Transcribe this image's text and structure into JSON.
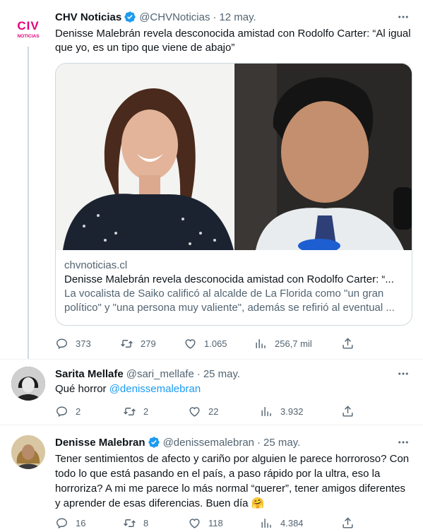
{
  "tweets": [
    {
      "name": "CHV Noticias",
      "handle": "@CHVNoticias",
      "separator": "·",
      "date": "12 may.",
      "logo_text": "NOTICIAS",
      "text": "Denisse Malebrán revela desconocida amistad con Rodolfo Carter: “Al igual que yo, es un tipo que viene de abajo”",
      "card": {
        "domain": "chvnoticias.cl",
        "title": "Denisse Malebrán revela desconocida amistad con Rodolfo Carter: “...",
        "desc": "La vocalista de Saiko calificó al alcalde de La Florida como \"un gran político\" y \"una persona muy valiente\", además se refirió al eventual ..."
      },
      "stats": {
        "replies": "373",
        "retweets": "279",
        "likes": "1.065",
        "views": "256,7 mil"
      }
    },
    {
      "name": "Sarita Mellafe",
      "handle": "@sari_mellafe",
      "separator": "·",
      "date": "25 may.",
      "text_plain": "Qué horror ",
      "mention": "@denissemalebran",
      "stats": {
        "replies": "2",
        "retweets": "2",
        "likes": "22",
        "views": "3.932"
      }
    },
    {
      "name": "Denisse Malebran",
      "handle": "@denissemalebran",
      "separator": "·",
      "date": "25 may.",
      "text": "Tener sentimientos de afecto y cariño por alguien le parece horroroso? Con todo lo que está pasando en el país, a paso rápido por la ultra, eso la horroriza? A mi me parece lo más normal “querer”, tener amigos diferentes y aprender de esas diferencias. Buen día 🤗",
      "stats": {
        "replies": "16",
        "retweets": "8",
        "likes": "118",
        "views": "4.384"
      }
    }
  ],
  "colors": {
    "brand": "#1d9bf0",
    "secondary_text": "#536471",
    "chv_red": "#e4007c"
  },
  "icons": [
    "reply-icon",
    "retweet-icon",
    "like-icon",
    "views-icon",
    "share-icon",
    "more-icon",
    "verified-icon"
  ]
}
